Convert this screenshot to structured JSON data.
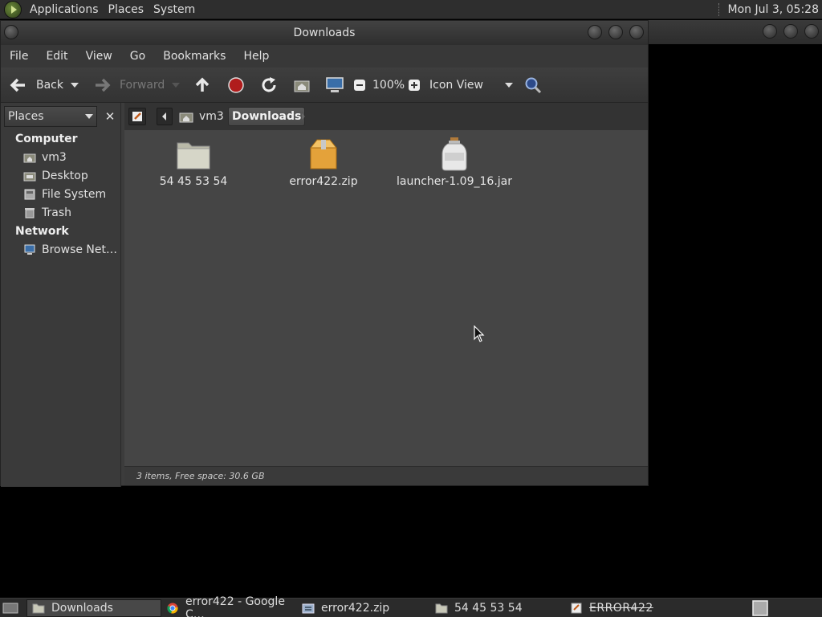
{
  "top_panel": {
    "menus": [
      "Applications",
      "Places",
      "System"
    ],
    "clock": "Mon Jul 3, 05:28"
  },
  "window": {
    "title": "Downloads",
    "menubar": [
      "File",
      "Edit",
      "View",
      "Go",
      "Bookmarks",
      "Help"
    ],
    "toolbar": {
      "back_label": "Back",
      "forward_label": "Forward",
      "zoom_level": "100%",
      "view_mode": "Icon View"
    },
    "location": {
      "crumbs": [
        "vm3",
        "Downloads"
      ]
    },
    "sidebar": {
      "selector_label": "Places",
      "sections": [
        {
          "title": "Computer",
          "items": [
            "vm3",
            "Desktop",
            "File System",
            "Trash"
          ]
        },
        {
          "title": "Network",
          "items": [
            "Browse Net…"
          ]
        }
      ]
    },
    "files": [
      {
        "name": "54 45 53 54",
        "icon": "folder-icon"
      },
      {
        "name": "error422.zip",
        "icon": "archive-icon"
      },
      {
        "name": "launcher-1.09_16.jar",
        "icon": "jar-icon"
      }
    ],
    "status": "3 items, Free space: 30.6 GB"
  },
  "taskbar": {
    "tasks": [
      "Downloads",
      "error422 - Google C…",
      "error422.zip",
      "54 45 53 54",
      "ERROR422"
    ]
  }
}
